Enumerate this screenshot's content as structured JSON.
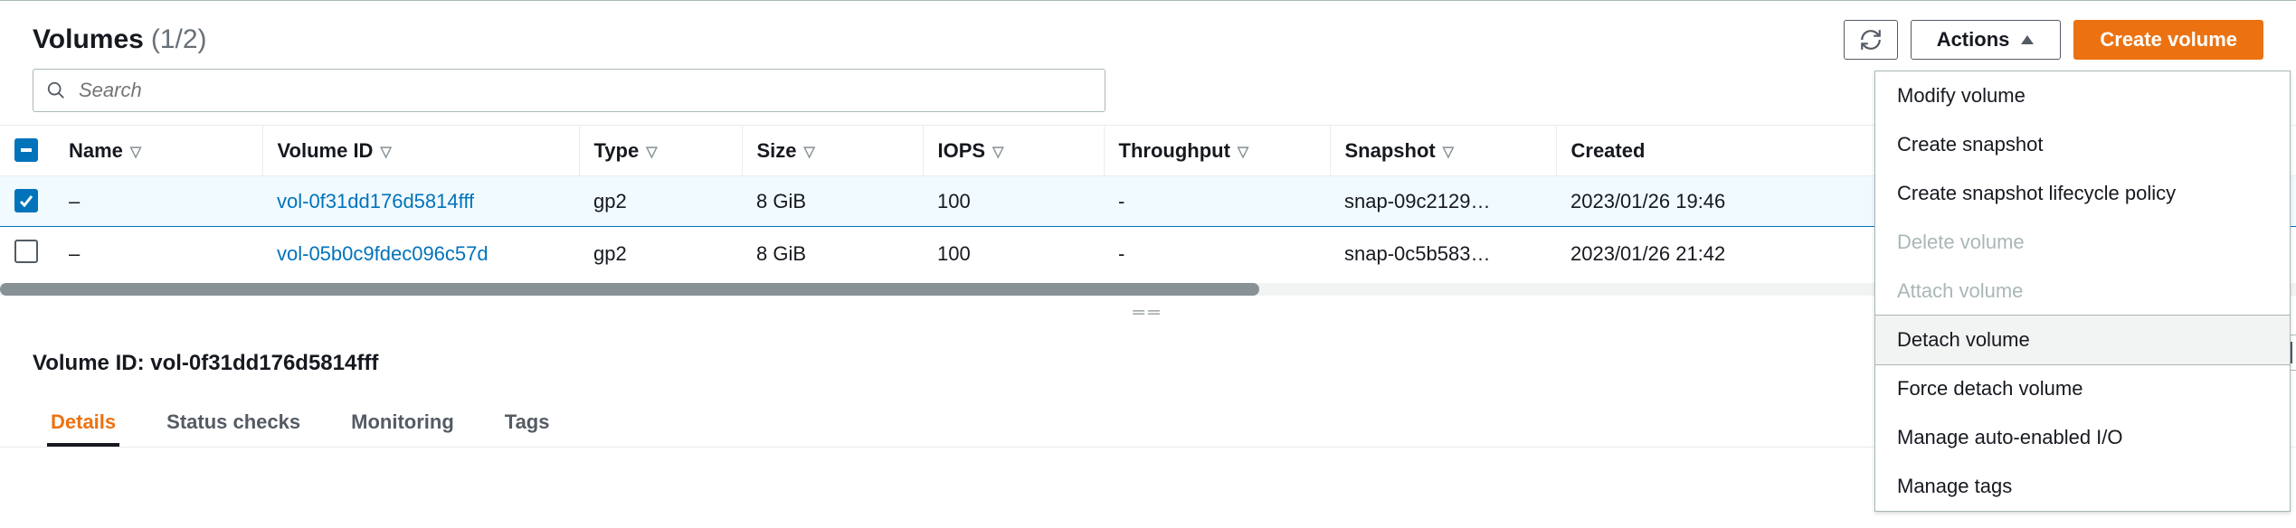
{
  "header": {
    "title": "Volumes",
    "count": "(1/2)",
    "refresh_label": "Refresh",
    "actions_label": "Actions",
    "create_label": "Create volume"
  },
  "search": {
    "placeholder": "Search"
  },
  "columns": [
    "Name",
    "Volume ID",
    "Type",
    "Size",
    "IOPS",
    "Throughput",
    "Snapshot",
    "Created"
  ],
  "rows": [
    {
      "selected": true,
      "name": "–",
      "volume_id": "vol-0f31dd176d5814fff",
      "type": "gp2",
      "size": "8 GiB",
      "iops": "100",
      "throughput": "-",
      "snapshot": "snap-09c2129…",
      "created": "2023/01/26 19:46"
    },
    {
      "selected": false,
      "name": "–",
      "volume_id": "vol-05b0c9fdec096c57d",
      "type": "gp2",
      "size": "8 GiB",
      "iops": "100",
      "throughput": "-",
      "snapshot": "snap-0c5b583…",
      "created": "2023/01/26 21:42"
    }
  ],
  "detail": {
    "title_prefix": "Volume ID: ",
    "volume_id": "vol-0f31dd176d5814fff"
  },
  "tabs": [
    {
      "label": "Details",
      "active": true
    },
    {
      "label": "Status checks",
      "active": false
    },
    {
      "label": "Monitoring",
      "active": false
    },
    {
      "label": "Tags",
      "active": false
    }
  ],
  "actions_menu": [
    {
      "label": "Modify volume",
      "state": "enabled"
    },
    {
      "label": "Create snapshot",
      "state": "enabled"
    },
    {
      "label": "Create snapshot lifecycle policy",
      "state": "enabled"
    },
    {
      "label": "Delete volume",
      "state": "disabled"
    },
    {
      "label": "Attach volume",
      "state": "disabled"
    },
    {
      "label": "Detach volume",
      "state": "hover"
    },
    {
      "label": "Force detach volume",
      "state": "enabled"
    },
    {
      "label": "Manage auto-enabled I/O",
      "state": "enabled"
    },
    {
      "label": "Manage tags",
      "state": "enabled"
    }
  ],
  "drag_handle": "══"
}
